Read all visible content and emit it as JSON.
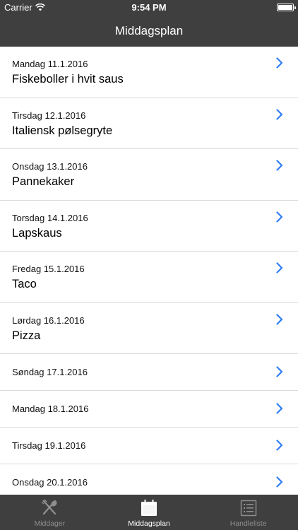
{
  "status_bar": {
    "carrier": "Carrier",
    "time": "9:54 PM"
  },
  "nav": {
    "title": "Middagsplan"
  },
  "days": [
    {
      "date": "Mandag 11.1.2016",
      "dish": "Fiskeboller i hvit saus"
    },
    {
      "date": "Tirsdag 12.1.2016",
      "dish": "Italiensk pølsegryte"
    },
    {
      "date": "Onsdag 13.1.2016",
      "dish": "Pannekaker"
    },
    {
      "date": "Torsdag 14.1.2016",
      "dish": "Lapskaus"
    },
    {
      "date": "Fredag 15.1.2016",
      "dish": "Taco"
    },
    {
      "date": "Lørdag 16.1.2016",
      "dish": "Pizza"
    },
    {
      "date": "Søndag 17.1.2016",
      "dish": ""
    },
    {
      "date": "Mandag 18.1.2016",
      "dish": ""
    },
    {
      "date": "Tirsdag 19.1.2016",
      "dish": ""
    },
    {
      "date": "Onsdag 20.1.2016",
      "dish": ""
    }
  ],
  "tabs": [
    {
      "label": "Middager",
      "icon": "utensils-icon",
      "active": false
    },
    {
      "label": "Middagsplan",
      "icon": "calendar-icon",
      "active": true
    },
    {
      "label": "Handleliste",
      "icon": "list-icon",
      "active": false
    }
  ],
  "colors": {
    "bar": "#3f3f3f",
    "accent": "#2f7ef6"
  }
}
